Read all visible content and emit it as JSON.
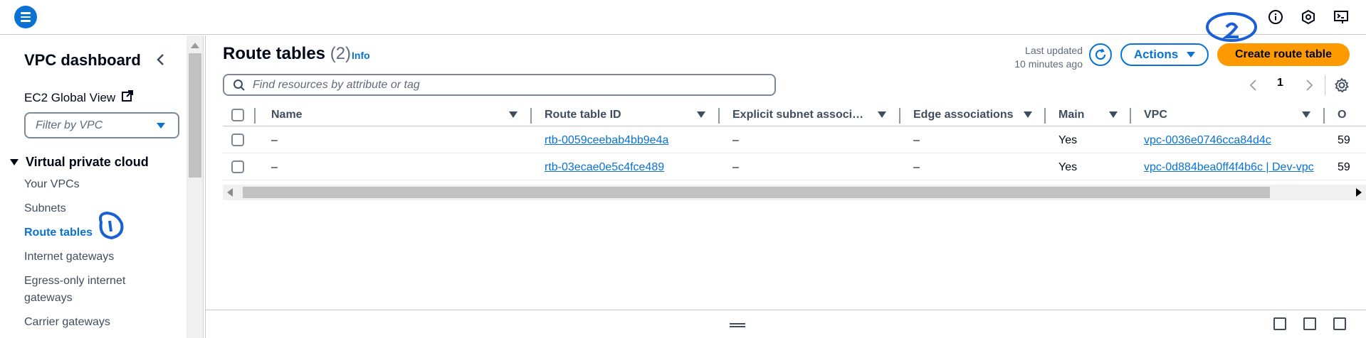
{
  "topbar": {
    "menu_icon": "hamburger-menu-icon",
    "icons": [
      "info-icon",
      "notifications-icon",
      "cloudshell-icon"
    ]
  },
  "sidebar": {
    "title": "VPC dashboard",
    "ec2_link": "EC2 Global View",
    "filter_placeholder": "Filter by VPC",
    "section": "Virtual private cloud",
    "items": [
      {
        "label": "Your VPCs"
      },
      {
        "label": "Subnets"
      },
      {
        "label": "Route tables",
        "active": true
      },
      {
        "label": "Internet gateways"
      },
      {
        "label": "Egress-only internet"
      },
      {
        "label": "gateways"
      },
      {
        "label": "Carrier gateways"
      }
    ]
  },
  "main": {
    "title": "Route tables",
    "count": "(2)",
    "info_link": "Info",
    "last_updated_label": "Last updated",
    "last_updated_value": "10 minutes ago",
    "actions_label": "Actions",
    "create_label": "Create route table",
    "search_placeholder": "Find resources by attribute or tag",
    "page": "1",
    "columns": [
      "Name",
      "Route table ID",
      "Explicit subnet associ…",
      "Edge associations",
      "Main",
      "VPC",
      "O"
    ],
    "rows": [
      {
        "name": "–",
        "id": "rtb-0059ceebab4bb9e4a",
        "explicit": "–",
        "edge": "–",
        "main": "Yes",
        "vpc": "vpc-0036e0746cca84d4c",
        "owner": "59"
      },
      {
        "name": "–",
        "id": "rtb-03ecae0e5c4fce489",
        "explicit": "–",
        "edge": "–",
        "main": "Yes",
        "vpc": "vpc-0d884bea0ff4f4b6c | Dev-vpc",
        "owner": "59"
      }
    ]
  },
  "colors": {
    "accent": "#0972d3",
    "primary_button": "#ff9900",
    "annotation": "#1b5fd6"
  }
}
